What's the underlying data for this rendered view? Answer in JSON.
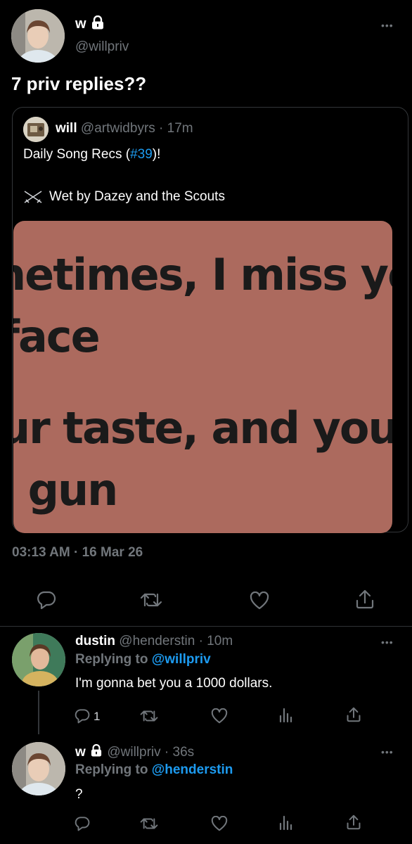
{
  "main_tweet": {
    "display_name": "w",
    "handle": "@willpriv",
    "text": "7 priv replies??",
    "more": "•••",
    "timestamp": "03:13 AM · 16 Mar 26",
    "quote": {
      "name": "will",
      "handle_time": "@artwidbyrs · 17m",
      "text_prefix": "Daily Song Recs (",
      "hashtag": "#39",
      "text_suffix": ")!",
      "song_line": "Wet by Dazey and the Scouts",
      "media_lines": [
        "netimes, I miss you",
        "face",
        "ur taste, and your",
        "' gun"
      ]
    }
  },
  "replies": [
    {
      "name": "dustin",
      "handle_time": "@henderstin · 10m",
      "replying_label": "Replying to ",
      "replying_to": "@willpriv",
      "text": "I'm gonna bet you a 1000 dollars.",
      "reply_count": "1",
      "more": "•••"
    },
    {
      "name": "w",
      "handle_time": "@willpriv · 36s",
      "replying_label": "Replying to ",
      "replying_to": "@henderstin",
      "text": "?",
      "more": "•••"
    }
  ],
  "colors": {
    "background": "#000000",
    "accent": "#1d9bf0",
    "secondary_text": "#71767b",
    "media_bg": "#ac6a5e"
  },
  "icons": [
    "lock-icon",
    "more-icon",
    "crossed-swords-icon",
    "reply-icon",
    "retweet-icon",
    "like-icon",
    "share-icon",
    "views-icon"
  ]
}
